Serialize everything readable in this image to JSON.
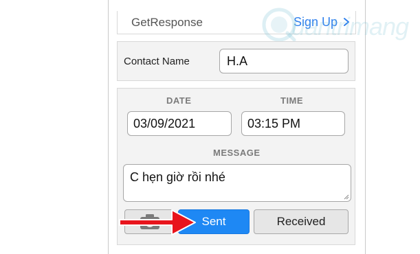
{
  "getresponse_row": {
    "name": "GetResponse",
    "signup_label": "Sign Up"
  },
  "watermark": {
    "text": "uantrimang"
  },
  "contact": {
    "label": "Contact Name",
    "value": "H.A"
  },
  "schedule": {
    "date_label": "DATE",
    "date_value": "03/09/2021",
    "time_label": "TIME",
    "time_value": "03:15 PM"
  },
  "message": {
    "label": "MESSAGE",
    "value": "C hẹn giờ rồi nhé"
  },
  "buttons": {
    "sent_label": "Sent",
    "received_label": "Received"
  },
  "icons": {
    "camera": "camera-icon",
    "chevron": "chevron-right-icon",
    "arrow": "red-arrow-annotation"
  },
  "colors": {
    "accent": "#1e88f4",
    "link": "#2f80ed",
    "arrow": "#e8141c"
  }
}
